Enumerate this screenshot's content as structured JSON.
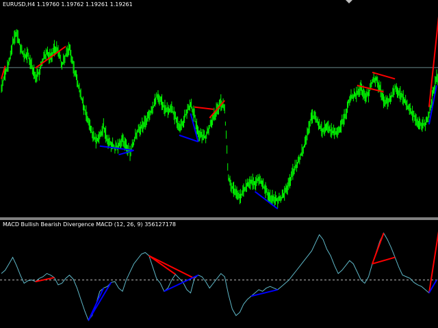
{
  "price_pane": {
    "symbol": "EURUSD,H4",
    "ohlc": "1.19760 1.19762 1.19261 1.19261"
  },
  "macd_pane": {
    "indicator": "MACD Bullish Bearish Divergence MACD (12, 26, 9) 356127178"
  },
  "colors": {
    "background": "#000000",
    "candles": "#00ff00",
    "macd_line": "#5fb8c8",
    "bearish": "#ff0000",
    "bullish": "#0000ff",
    "price_line": "#6a8a8c",
    "zero_line": "#c0c0c0"
  },
  "chart_data": [
    {
      "type": "line",
      "name": "price",
      "series": [
        {
          "values": [
            1.188,
            1.191,
            1.1935,
            1.1985,
            1.201,
            1.1975,
            1.195,
            1.1955,
            1.193,
            1.1905,
            1.1915,
            1.1945,
            1.196,
            1.195,
            1.197,
            1.1965,
            1.193,
            1.1955,
            1.1975,
            1.193,
            1.1895,
            1.186,
            1.183,
            1.1805,
            1.1775,
            1.1755,
            1.1765,
            1.179,
            1.176,
            1.175,
            1.174,
            1.1745,
            1.176,
            1.1745,
            1.173,
            1.1755,
            1.178,
            1.179,
            1.18,
            1.1815,
            1.183,
            1.186,
            1.1855,
            1.1835,
            1.1825,
            1.183,
            1.181,
            1.179,
            1.18,
            1.1825,
            1.184,
            1.1815,
            1.1775,
            1.177,
            1.1765,
            1.179,
            1.181,
            1.183,
            1.1845,
            1.183,
            1.167,
            1.165,
            1.164,
            1.1625,
            1.164,
            1.1655,
            1.1665,
            1.166,
            1.167,
            1.1655,
            1.164,
            1.1625,
            1.1625,
            1.162,
            1.1625,
            1.164,
            1.166,
            1.1685,
            1.17,
            1.172,
            1.1745,
            1.178,
            1.1815,
            1.181,
            1.179,
            1.178,
            1.1795,
            1.178,
            1.1775,
            1.1775,
            1.18,
            1.182,
            1.1855,
            1.186,
            1.1865,
            1.188,
            1.186,
            1.1865,
            1.1895,
            1.19,
            1.188,
            1.185,
            1.1845,
            1.1855,
            1.188,
            1.187,
            1.186,
            1.184,
            1.1825,
            1.1815,
            1.18,
            1.1795,
            1.1795,
            1.1815,
            1.1865,
            1.1905
          ]
        }
      ],
      "current_price_line": 1.19261
    },
    {
      "type": "line",
      "name": "macd",
      "series": [
        {
          "values": [
            0.0008,
            0.0012,
            0.002,
            0.0028,
            0.0018,
            0.0006,
            -0.0004,
            -0.0001,
            0.0,
            -0.0002,
            0.0002,
            0.0004,
            0.0008,
            0.0006,
            0.0003,
            -0.0006,
            -0.0004,
            0.0002,
            0.0006,
            0.0001,
            -0.001,
            -0.0024,
            -0.0038,
            -0.005,
            -0.0044,
            -0.003,
            -0.0014,
            -0.001,
            -0.0008,
            -0.0003,
            -0.0002,
            -0.001,
            -0.0014,
            0.0,
            0.001,
            0.002,
            0.0026,
            0.0032,
            0.0034,
            0.003,
            0.0016,
            0.0002,
            -0.0004,
            -0.0014,
            -0.001,
            0.0,
            0.0007,
            0.0002,
            -0.0003,
            -0.0012,
            -0.0016,
            0.0002,
            0.0006,
            0.0004,
            -0.0002,
            -0.001,
            -0.0004,
            0.0002,
            0.0008,
            0.0004,
            -0.0018,
            -0.0036,
            -0.0044,
            -0.004,
            -0.003,
            -0.0024,
            -0.002,
            -0.0016,
            -0.0012,
            -0.0014,
            -0.001,
            -0.0008,
            -0.001,
            -0.0012,
            -0.0008,
            -0.0004,
            0.0,
            0.0006,
            0.0012,
            0.0018,
            0.0024,
            0.003,
            0.0036,
            0.0046,
            0.0056,
            0.005,
            0.0038,
            0.003,
            0.0018,
            0.0008,
            0.0012,
            0.0018,
            0.0024,
            0.002,
            0.001,
            0.0,
            -0.0004,
            0.0004,
            0.002,
            0.0034,
            0.0048,
            0.0058,
            0.005,
            0.004,
            0.0028,
            0.0016,
            0.0006,
            0.0004,
            0.0002,
            -0.0003,
            -0.0006,
            -0.0008,
            -0.0012,
            -0.0016,
            -0.0008,
            0.0
          ]
        }
      ]
    }
  ]
}
